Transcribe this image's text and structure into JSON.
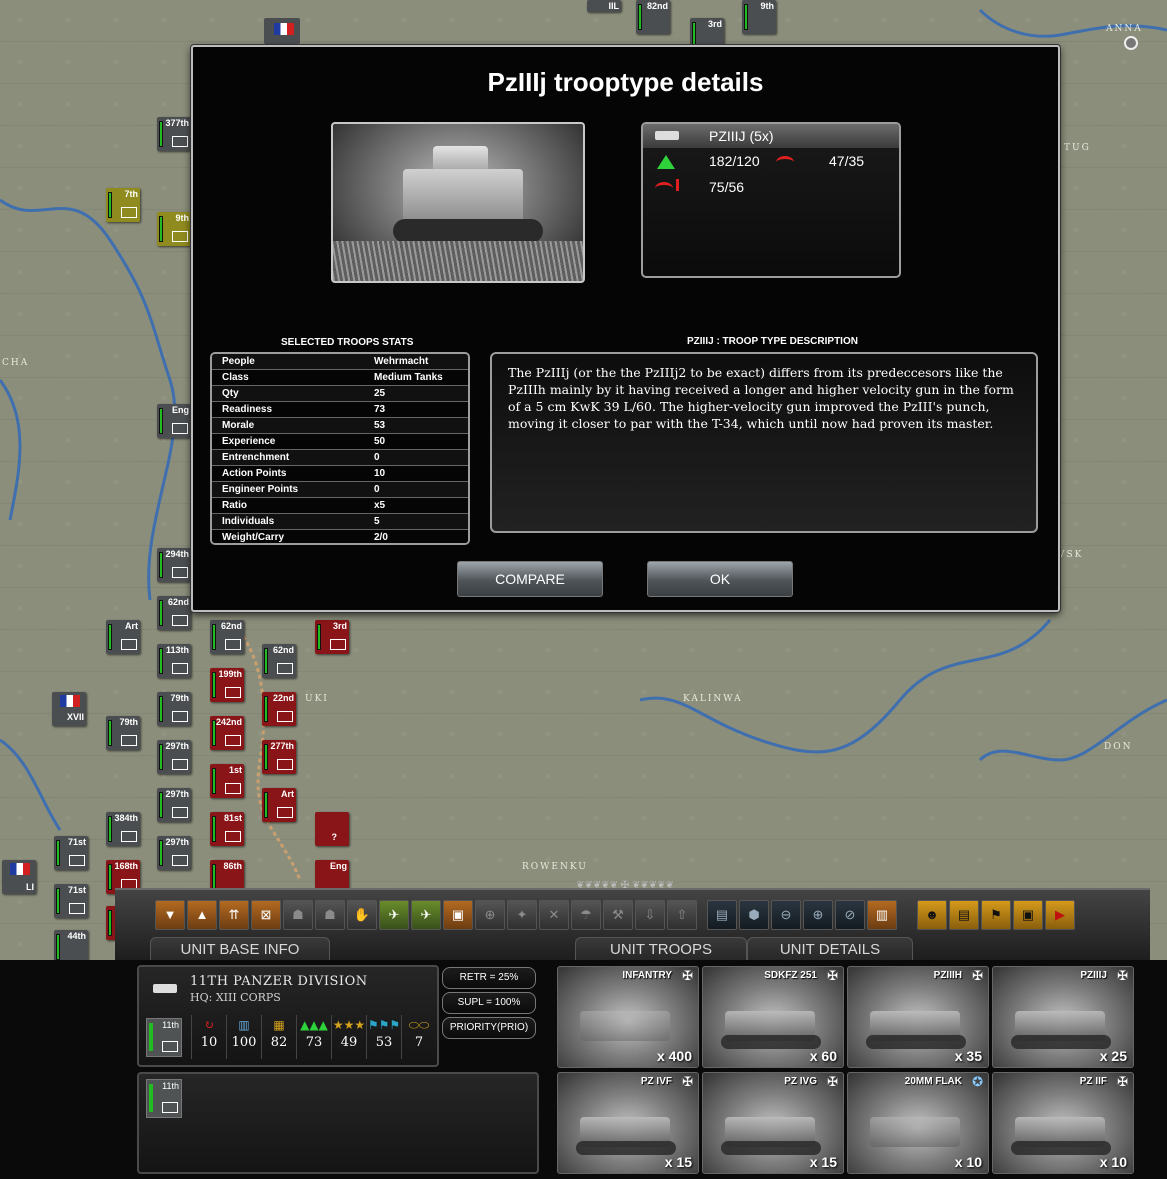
{
  "map": {
    "labels": [
      "ANNA",
      "TUG",
      "CHA",
      "KALINWA",
      "ROWENKU",
      "DON",
      "VSK",
      "UKI"
    ],
    "counters": [
      "377th",
      "7th",
      "9th",
      "Eng",
      "294th",
      "62nd",
      "Art",
      "113th",
      "79th",
      "XVII",
      "297th",
      "384th",
      "71st",
      "LI",
      "168th",
      "316",
      "44th",
      "62nd",
      "199th",
      "242nd",
      "1st",
      "81st",
      "86th",
      "22nd",
      "277th",
      "Art",
      "3rd",
      "?",
      "Eng",
      "IIL",
      "82nd",
      "3rd",
      "9th"
    ]
  },
  "dialog": {
    "title": "PzIIIj trooptype details",
    "stat_card": {
      "name": "PZIIIJ (5x)",
      "attack_soft": "182/120",
      "attack_hard": "47/35",
      "defense": "75/56"
    },
    "stats_title": "SELECTED TROOPS STATS",
    "stats": [
      {
        "key": "People",
        "value": "Wehrmacht"
      },
      {
        "key": "Class",
        "value": "Medium Tanks"
      },
      {
        "key": "Qty",
        "value": "25"
      },
      {
        "key": "Readiness",
        "value": "73"
      },
      {
        "key": "Morale",
        "value": "53"
      },
      {
        "key": "Experience",
        "value": "50"
      },
      {
        "key": "Entrenchment",
        "value": "0"
      },
      {
        "key": "Action Points",
        "value": "10"
      },
      {
        "key": "Engineer Points",
        "value": "0"
      },
      {
        "key": "Ratio",
        "value": "x5"
      },
      {
        "key": "Individuals",
        "value": "5"
      },
      {
        "key": "Weight/Carry",
        "value": "2/0"
      }
    ],
    "desc_title": "PZIIIJ : TROOP TYPE DESCRIPTION",
    "description": "The PzIIIj (or the the PzIIIj2 to be exact) differs from its predeccesors like the PzIIIh mainly by it having received a longer and higher velocity gun in the form of a 5 cm KwK 39 L/60. The higher-velocity gun improved the PzIII's punch, moving it closer to par with the T-34, which until now had proven its master.",
    "compare_label": "COMPARE",
    "ok_label": "OK"
  },
  "tabs": {
    "unit_base_info": "UNIT BASE INFO",
    "unit_troops": "UNIT TROOPS",
    "unit_details": "UNIT DETAILS"
  },
  "unit": {
    "name": "11TH PANZER DIVISION",
    "hq": "HQ: XIII CORPS",
    "badge": "11th",
    "stats": [
      "10",
      "100",
      "82",
      "73",
      "49",
      "53",
      "7"
    ],
    "retr": "RETR = 25%",
    "supl": "SUPL = 100%(100%)",
    "priority": "PRIORITY(PRIO)"
  },
  "troops": [
    {
      "name": "INFANTRY",
      "qty": "x 400"
    },
    {
      "name": "SDKFZ 251",
      "qty": "x 60"
    },
    {
      "name": "PZIIIH",
      "qty": "x 35"
    },
    {
      "name": "PZIIIJ",
      "qty": "x 25"
    },
    {
      "name": "PZ IVF",
      "qty": "x 15"
    },
    {
      "name": "PZ IVG",
      "qty": "x 15"
    },
    {
      "name": "20MM FLAK",
      "qty": "x 10"
    },
    {
      "name": "PZ IIF",
      "qty": "x 10"
    }
  ],
  "colors": {
    "accent_orange": "#b36a21",
    "frame": "#bdbdbd",
    "soft_attack": "#2ed23a",
    "hard_attack": "#e02020"
  }
}
